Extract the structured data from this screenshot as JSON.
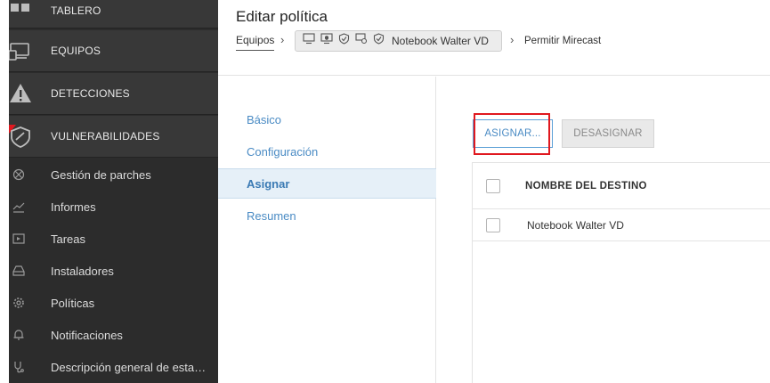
{
  "sidebar": {
    "sections": [
      {
        "label": "TABLERO",
        "icon": "dashboard-icon"
      },
      {
        "label": "EQUIPOS",
        "icon": "devices-icon"
      },
      {
        "label": "DETECCIONES",
        "icon": "warning-icon"
      },
      {
        "label": "VULNERABILIDADES",
        "icon": "shield-icon"
      }
    ],
    "items": [
      {
        "label": "Gestión de parches",
        "icon": "patch-icon"
      },
      {
        "label": "Informes",
        "icon": "chart-icon"
      },
      {
        "label": "Tareas",
        "icon": "tasks-icon"
      },
      {
        "label": "Instaladores",
        "icon": "installer-icon"
      },
      {
        "label": "Políticas",
        "icon": "gear-icon"
      },
      {
        "label": "Notificaciones",
        "icon": "bell-icon"
      },
      {
        "label": "Descripción general de esta…",
        "icon": "stethoscope-icon"
      }
    ]
  },
  "header": {
    "title": "Editar política",
    "breadcrumb": {
      "root": "Equipos",
      "chip_label": "Notebook Walter VD",
      "chip_icons": [
        "monitor-icon",
        "monitor-shield-icon",
        "shield-icon",
        "gear-computer-icon",
        "shield-check-icon"
      ],
      "current": "Permitir Mirecast"
    }
  },
  "steps": [
    "Básico",
    "Configuración",
    "Asignar",
    "Resumen"
  ],
  "main": {
    "assign_button": "ASIGNAR...",
    "unassign_button": "DESASIGNAR",
    "table": {
      "column_header": "NOMBRE DEL DESTINO",
      "rows": [
        "Notebook Walter VD"
      ]
    }
  },
  "colors": {
    "sidebar_bg": "#2c2c2c",
    "accent": "#4a8bc4",
    "highlight": "#e0181f"
  }
}
